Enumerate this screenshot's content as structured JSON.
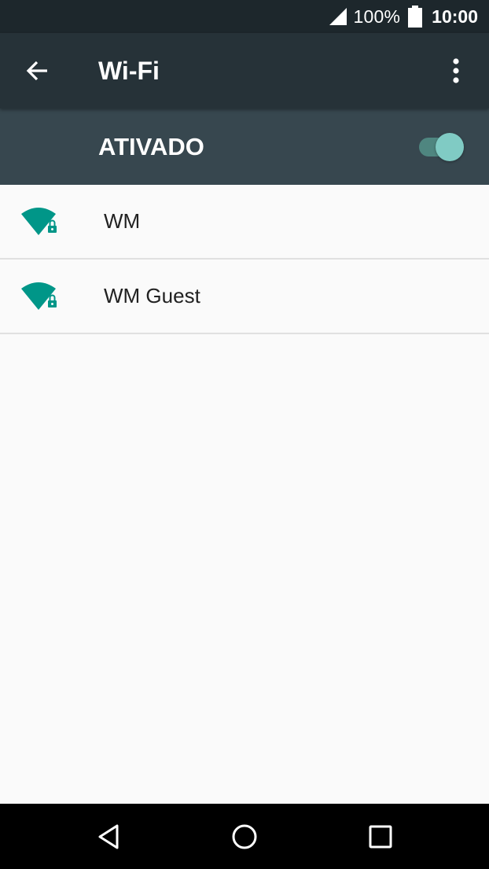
{
  "status_bar": {
    "battery_percent": "100%",
    "time": "10:00"
  },
  "app_bar": {
    "title": "Wi-Fi"
  },
  "master_switch": {
    "label": "ATIVADO",
    "on": true
  },
  "networks": [
    {
      "name": "WM",
      "secured": true
    },
    {
      "name": "WM Guest",
      "secured": true
    }
  ],
  "icons": {
    "signal": "cellular-signal-icon",
    "battery": "battery-full-icon",
    "back": "arrow-back-icon",
    "overflow": "more-vert-icon",
    "wifi": "wifi-lock-icon",
    "nav_back": "nav-back-triangle-icon",
    "nav_home": "nav-home-circle-icon",
    "nav_recents": "nav-recents-square-icon"
  },
  "colors": {
    "status_bar": "#1d272c",
    "app_bar": "#263238",
    "switch_bar": "#37474f",
    "accent": "#009688",
    "toggle_thumb": "#80cbc4",
    "background": "#fafafa"
  }
}
